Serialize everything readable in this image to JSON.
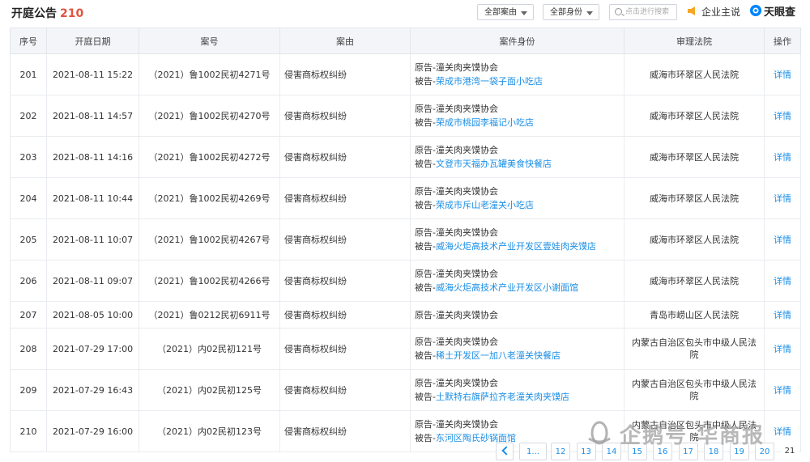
{
  "header": {
    "title": "开庭公告",
    "count": "210",
    "filter_cause": "全部案由",
    "filter_role": "全部身份",
    "search_placeholder": "点击进行搜索",
    "enterprise_label": "企业主说",
    "brand_name": "天眼查"
  },
  "columns": [
    "序号",
    "开庭日期",
    "案号",
    "案由",
    "案件身份",
    "审理法院",
    "操作"
  ],
  "rows": [
    {
      "no": "201",
      "date": "2021-08-11 15:22",
      "case_no": "（2021）鲁1002民初4271号",
      "cause": "侵害商标权纠纷",
      "plaintiff": "原告-潼关肉夹馍协会",
      "defendant_prefix": "被告-",
      "defendant": "荣成市港湾一袋子面小吃店",
      "court": "威海市环翠区人民法院",
      "action": "详情"
    },
    {
      "no": "202",
      "date": "2021-08-11 14:57",
      "case_no": "（2021）鲁1002民初4270号",
      "cause": "侵害商标权纠纷",
      "plaintiff": "原告-潼关肉夹馍协会",
      "defendant_prefix": "被告-",
      "defendant": "荣成市桃园李福记小吃店",
      "court": "威海市环翠区人民法院",
      "action": "详情"
    },
    {
      "no": "203",
      "date": "2021-08-11 14:16",
      "case_no": "（2021）鲁1002民初4272号",
      "cause": "侵害商标权纠纷",
      "plaintiff": "原告-潼关肉夹馍协会",
      "defendant_prefix": "被告-",
      "defendant": "文登市天福办瓦罐美食快餐店",
      "court": "威海市环翠区人民法院",
      "action": "详情"
    },
    {
      "no": "204",
      "date": "2021-08-11 10:44",
      "case_no": "（2021）鲁1002民初4269号",
      "cause": "侵害商标权纠纷",
      "plaintiff": "原告-潼关肉夹馍协会",
      "defendant_prefix": "被告-",
      "defendant": "荣成市斥山老潼关小吃店",
      "court": "威海市环翠区人民法院",
      "action": "详情"
    },
    {
      "no": "205",
      "date": "2021-08-11 10:07",
      "case_no": "（2021）鲁1002民初4267号",
      "cause": "侵害商标权纠纷",
      "plaintiff": "原告-潼关肉夹馍协会",
      "defendant_prefix": "被告-",
      "defendant": "威海火炬高技术产业开发区壹娃肉夹馍店",
      "court": "威海市环翠区人民法院",
      "action": "详情"
    },
    {
      "no": "206",
      "date": "2021-08-11 09:07",
      "case_no": "（2021）鲁1002民初4266号",
      "cause": "侵害商标权纠纷",
      "plaintiff": "原告-潼关肉夹馍协会",
      "defendant_prefix": "被告-",
      "defendant": "威海火炬高技术产业开发区小谢面馆",
      "court": "威海市环翠区人民法院",
      "action": "详情"
    },
    {
      "no": "207",
      "date": "2021-08-05 10:00",
      "case_no": "（2021）鲁0212民初6911号",
      "cause": "侵害商标权纠纷",
      "plaintiff": "原告-潼关肉夹馍协会",
      "defendant_prefix": "",
      "defendant": "",
      "court": "青岛市崂山区人民法院",
      "action": "详情"
    },
    {
      "no": "208",
      "date": "2021-07-29 17:00",
      "case_no": "（2021）内02民初121号",
      "cause": "侵害商标权纠纷",
      "plaintiff": "原告-潼关肉夹馍协会",
      "defendant_prefix": "被告-",
      "defendant": "稀土开发区一加八老潼关快餐店",
      "court": "内蒙古自治区包头市中级人民法院",
      "action": "详情"
    },
    {
      "no": "209",
      "date": "2021-07-29 16:43",
      "case_no": "（2021）内02民初125号",
      "cause": "侵害商标权纠纷",
      "plaintiff": "原告-潼关肉夹馍协会",
      "defendant_prefix": "被告-",
      "defendant": "土默特右旗萨拉齐老潼关肉夹馍店",
      "court": "内蒙古自治区包头市中级人民法院",
      "action": "详情"
    },
    {
      "no": "210",
      "date": "2021-07-29 16:00",
      "case_no": "（2021）内02民初123号",
      "cause": "侵害商标权纠纷",
      "plaintiff": "原告-潼关肉夹馍协会",
      "defendant_prefix": "被告-",
      "defendant": "东河区陶氏砂锅面馆",
      "court": "内蒙古自治区包头市中级人民法院",
      "action": "详情"
    }
  ],
  "pagination": {
    "first": "1...",
    "pages": [
      "12",
      "13",
      "14",
      "15",
      "16",
      "17",
      "18",
      "19",
      "20"
    ],
    "current": "21"
  },
  "watermark": {
    "text": "企鹅号 华商报"
  },
  "colors": {
    "accent": "#1a8ee6",
    "count_red": "#e2533f",
    "header_bg": "#f3f5f8"
  }
}
